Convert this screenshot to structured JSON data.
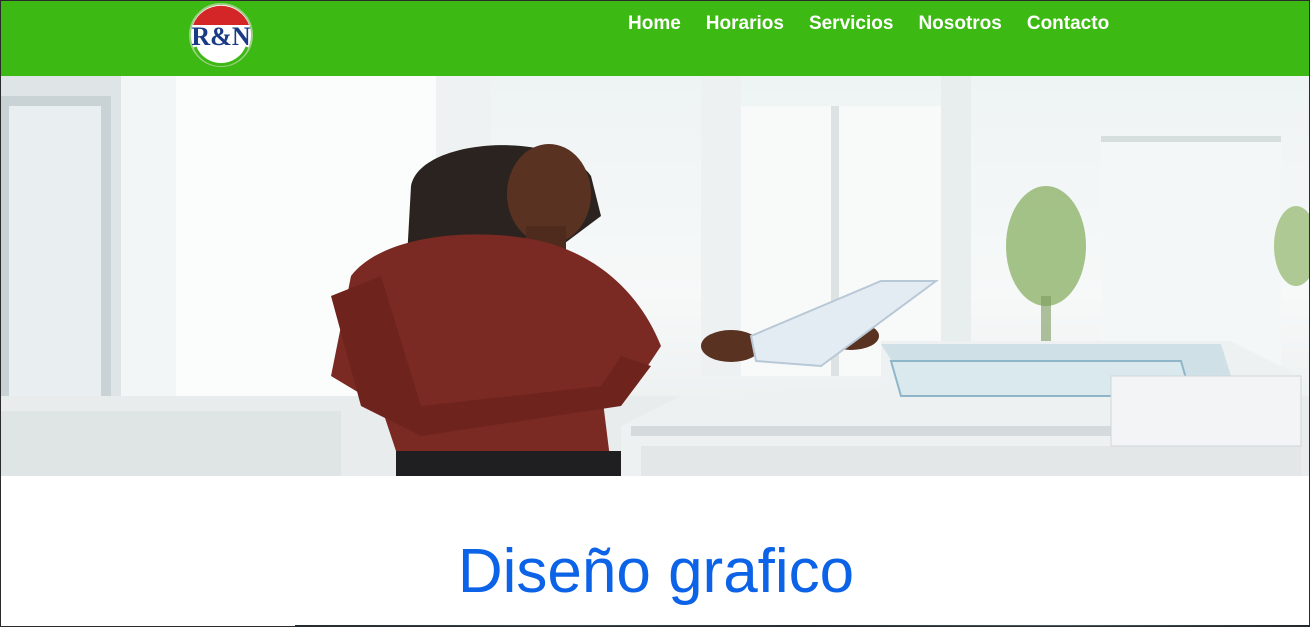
{
  "header": {
    "logo_text": "R&N",
    "nav": [
      {
        "label": "Home"
      },
      {
        "label": "Horarios"
      },
      {
        "label": "Servicios"
      },
      {
        "label": "Nosotros"
      },
      {
        "label": "Contacto"
      }
    ]
  },
  "hero": {
    "image_description_icon": "photo-woman-at-copier"
  },
  "section": {
    "title": "Diseño grafico"
  },
  "colors": {
    "header_bg": "#3cb912",
    "nav_text": "#ffffff",
    "title_color": "#0c63e7"
  }
}
